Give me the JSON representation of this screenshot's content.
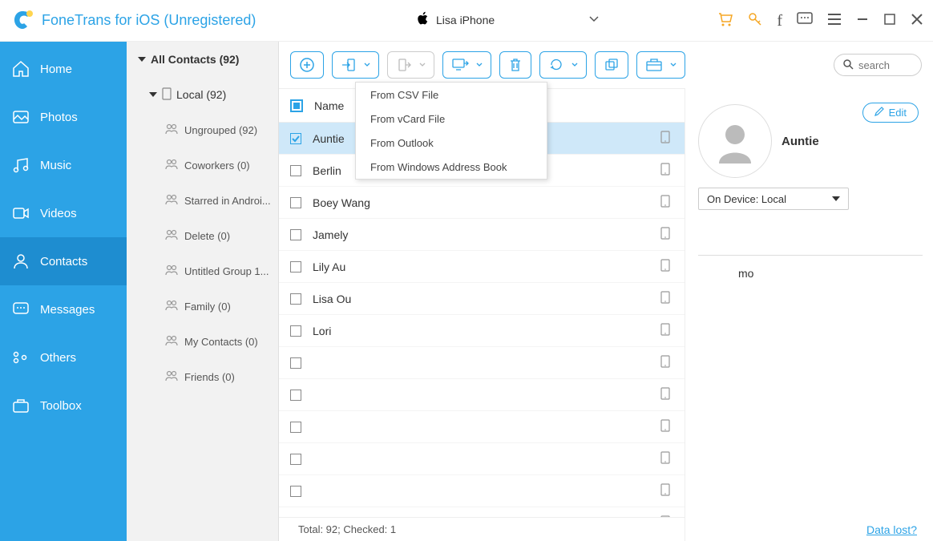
{
  "app_title": "FoneTrans for iOS (Unregistered)",
  "device_name": "Lisa iPhone",
  "sidebar": [
    {
      "label": "Home"
    },
    {
      "label": "Photos"
    },
    {
      "label": "Music"
    },
    {
      "label": "Videos"
    },
    {
      "label": "Contacts"
    },
    {
      "label": "Messages"
    },
    {
      "label": "Others"
    },
    {
      "label": "Toolbox"
    }
  ],
  "groups": {
    "header": "All Contacts  (92)",
    "local": "Local  (92)",
    "items": [
      "Ungrouped  (92)",
      "Coworkers  (0)",
      "Starred in Androi...",
      "Delete  (0)",
      "Untitled Group 1...",
      "Family  (0)",
      "My Contacts  (0)",
      "Friends  (0)"
    ]
  },
  "list_header": "Name",
  "contacts": [
    {
      "name": "Auntie",
      "selected": true
    },
    {
      "name": "Berlin"
    },
    {
      "name": "Boey Wang"
    },
    {
      "name": "Jamely"
    },
    {
      "name": "Lily Au"
    },
    {
      "name": "Lisa Ou"
    },
    {
      "name": "Lori"
    },
    {
      "name": ""
    },
    {
      "name": ""
    },
    {
      "name": ""
    },
    {
      "name": ""
    },
    {
      "name": ""
    },
    {
      "name": ""
    }
  ],
  "dropdown": [
    "From CSV File",
    "From vCard File",
    "From Outlook",
    "From Windows Address Book"
  ],
  "status": "Total: 92; Checked: 1",
  "data_lost": "Data lost?",
  "search_placeholder": "search",
  "detail": {
    "name": "Auntie",
    "edit": "Edit",
    "device": "On Device: Local",
    "mo": "mo"
  }
}
